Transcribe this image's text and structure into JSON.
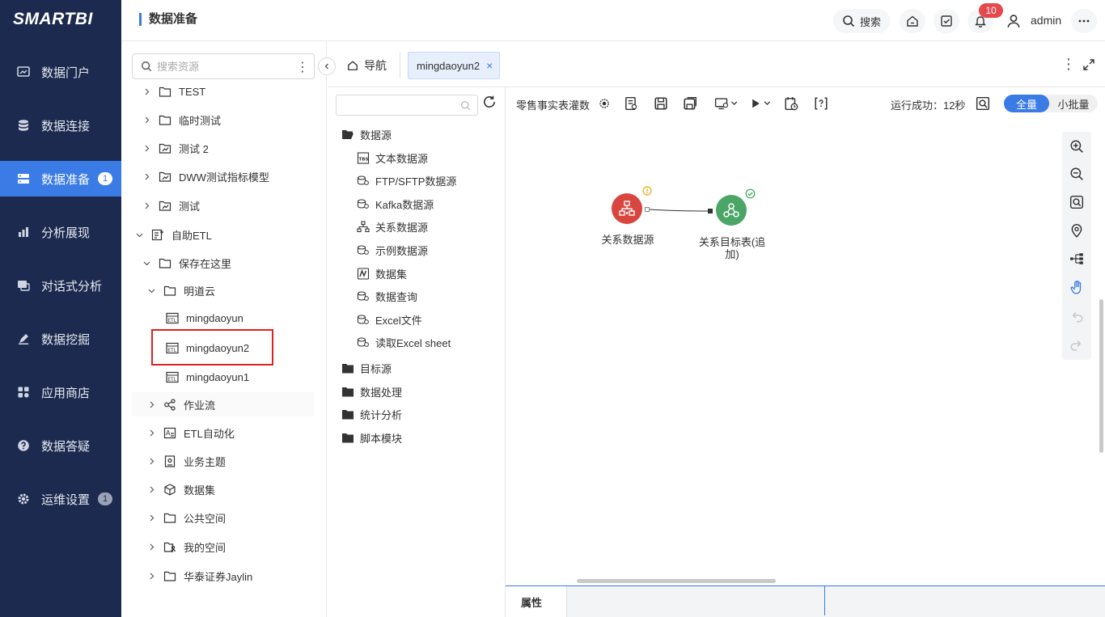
{
  "app": {
    "logo": "SMARTBI"
  },
  "nav": {
    "items": [
      {
        "label": "数据门户",
        "icon": "portal-icon"
      },
      {
        "label": "数据连接",
        "icon": "database-icon"
      },
      {
        "label": "数据准备",
        "icon": "prep-icon",
        "badge": "1",
        "active": true
      },
      {
        "label": "分析展现",
        "icon": "chart-icon"
      },
      {
        "label": "对话式分析",
        "icon": "chat-icon"
      },
      {
        "label": "数据挖掘",
        "icon": "mining-icon"
      },
      {
        "label": "应用商店",
        "icon": "store-icon"
      },
      {
        "label": "数据答疑",
        "icon": "question-icon"
      },
      {
        "label": "运维设置",
        "icon": "settings-icon",
        "badge": "1"
      }
    ]
  },
  "header": {
    "title": "数据准备",
    "search_label": "搜索",
    "notification_count": "10",
    "user": "admin"
  },
  "resources": {
    "search_placeholder": "搜索资源",
    "tree": [
      {
        "label": "TEST"
      },
      {
        "label": "临时测试"
      },
      {
        "label": "测试 2"
      },
      {
        "label": "DWW测试指标模型"
      },
      {
        "label": "测试"
      },
      {
        "label": "自助ETL"
      },
      {
        "label": "保存在这里"
      },
      {
        "label": "明道云"
      },
      {
        "label": "mingdaoyun"
      },
      {
        "label": "mingdaoyun2"
      },
      {
        "label": "mingdaoyun1"
      },
      {
        "label": "作业流"
      },
      {
        "label": "ETL自动化"
      },
      {
        "label": "业务主题"
      },
      {
        "label": "数据集"
      },
      {
        "label": "公共空间"
      },
      {
        "label": "我的空间"
      },
      {
        "label": "华泰证券Jaylin"
      }
    ]
  },
  "tabs": {
    "nav_label": "导航",
    "doc_label": "mingdaoyun2",
    "close": "×"
  },
  "palette": {
    "groups": [
      {
        "label": "数据源"
      },
      {
        "label": "文本数据源"
      },
      {
        "label": "FTP/SFTP数据源"
      },
      {
        "label": "Kafka数据源"
      },
      {
        "label": "关系数据源"
      },
      {
        "label": "示例数据源"
      },
      {
        "label": "数据集"
      },
      {
        "label": "数据查询"
      },
      {
        "label": "Excel文件"
      },
      {
        "label": "读取Excel sheet"
      },
      {
        "label": "目标源"
      },
      {
        "label": "数据处理"
      },
      {
        "label": "统计分析"
      },
      {
        "label": "脚本模块"
      }
    ]
  },
  "canvas": {
    "flow_name": "零售事实表灌数",
    "run_status": "运行成功：12秒",
    "mode_full": "全量",
    "mode_small": "小批量",
    "nodes": {
      "source_label": "关系数据源",
      "target_label_1": "关系目标表(追",
      "target_label_2": "加)"
    },
    "colors": {
      "source": "#d9463f",
      "target": "#4aa567",
      "accent": "#3a7be5"
    }
  },
  "props": {
    "tab_label": "属性"
  }
}
